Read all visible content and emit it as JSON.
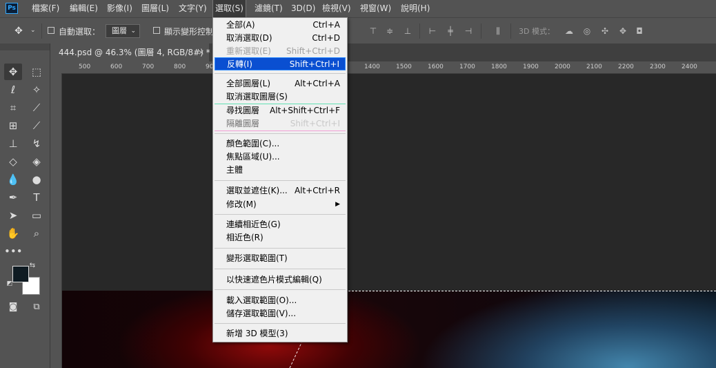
{
  "menubar": {
    "logo": "Ps",
    "items": [
      {
        "label": "檔案(F)"
      },
      {
        "label": "編輯(E)"
      },
      {
        "label": "影像(I)"
      },
      {
        "label": "圖層(L)"
      },
      {
        "label": "文字(Y)"
      },
      {
        "label": "選取(S)",
        "active": true
      },
      {
        "label": "濾鏡(T)"
      },
      {
        "label": "3D(D)"
      },
      {
        "label": "檢視(V)"
      },
      {
        "label": "視窗(W)"
      },
      {
        "label": "說明(H)"
      }
    ]
  },
  "options_bar": {
    "auto_select_label": "自動選取：",
    "auto_select_value": "圖層",
    "show_transform_label": "顯示變形控制",
    "mode_label": "3D 模式："
  },
  "document": {
    "tab_title": "444.psd @ 46.3% (圖層 4, RGB/8#) *",
    "close_glyph": "×"
  },
  "ruler": {
    "labels": [
      "500",
      "600",
      "700",
      "800",
      "900",
      "1400",
      "1500",
      "1600",
      "1700",
      "1800",
      "1900",
      "2000",
      "2100",
      "2200",
      "2300",
      "2400"
    ]
  },
  "select_menu": {
    "items": [
      {
        "label": "全部(A)",
        "shortcut": "Ctrl+A"
      },
      {
        "label": "取消選取(D)",
        "shortcut": "Ctrl+D"
      },
      {
        "label": "重新選取(E)",
        "shortcut": "Shift+Ctrl+D",
        "disabled": true
      },
      {
        "label": "反轉(I)",
        "shortcut": "Shift+Ctrl+I",
        "highlight": true
      },
      {
        "label": "全部圖層(L)",
        "shortcut": "Alt+Ctrl+A"
      },
      {
        "label": "取消選取圖層(S)",
        "shortcut": ""
      },
      {
        "label": "尋找圖層",
        "shortcut": "Alt+Shift+Ctrl+F"
      },
      {
        "label": "隔離圖層",
        "shortcut": "Shift+Ctrl+I",
        "disabled": true
      },
      {
        "label": "顏色範圍(C)...",
        "shortcut": ""
      },
      {
        "label": "焦點區域(U)...",
        "shortcut": ""
      },
      {
        "label": "主體",
        "shortcut": ""
      },
      {
        "label": "選取並遮住(K)...",
        "shortcut": "Alt+Ctrl+R"
      },
      {
        "label": "修改(M)",
        "shortcut": "",
        "submenu": true
      },
      {
        "label": "連續相近色(G)",
        "shortcut": ""
      },
      {
        "label": "相近色(R)",
        "shortcut": ""
      },
      {
        "label": "變形選取範圍(T)",
        "shortcut": ""
      },
      {
        "label": "以快速遮色片模式編輯(Q)",
        "shortcut": ""
      },
      {
        "label": "載入選取範圍(O)...",
        "shortcut": ""
      },
      {
        "label": "儲存選取範圍(V)...",
        "shortcut": ""
      },
      {
        "label": "新增 3D 模型(3)",
        "shortcut": ""
      }
    ]
  },
  "colors": {
    "accent_highlight": "#0a4fd1",
    "foreground_swatch": "#0f1b22",
    "background_swatch": "#ffffff"
  }
}
